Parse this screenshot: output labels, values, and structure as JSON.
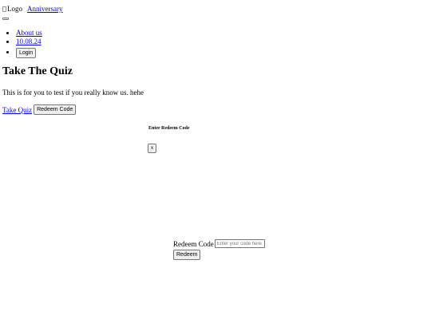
{
  "header": {
    "logo_alt": "Logo",
    "brand_link": "Anniversary"
  },
  "nav": {
    "items": [
      {
        "label": "About us"
      },
      {
        "label": "10.08.24"
      }
    ],
    "login_label": "Login"
  },
  "main": {
    "title": "Take The Quiz",
    "subtitle": "This is for you to test if you really know us. hehe",
    "take_quiz_link": "Take Quiz",
    "redeem_code_button": "Redeem Code"
  },
  "modal": {
    "title": "Enter Redeem Code",
    "close_label": "x"
  },
  "redeem_form": {
    "label": "Redeem Code",
    "placeholder": "Enter your code here",
    "value": "",
    "submit_label": "Redeem"
  }
}
